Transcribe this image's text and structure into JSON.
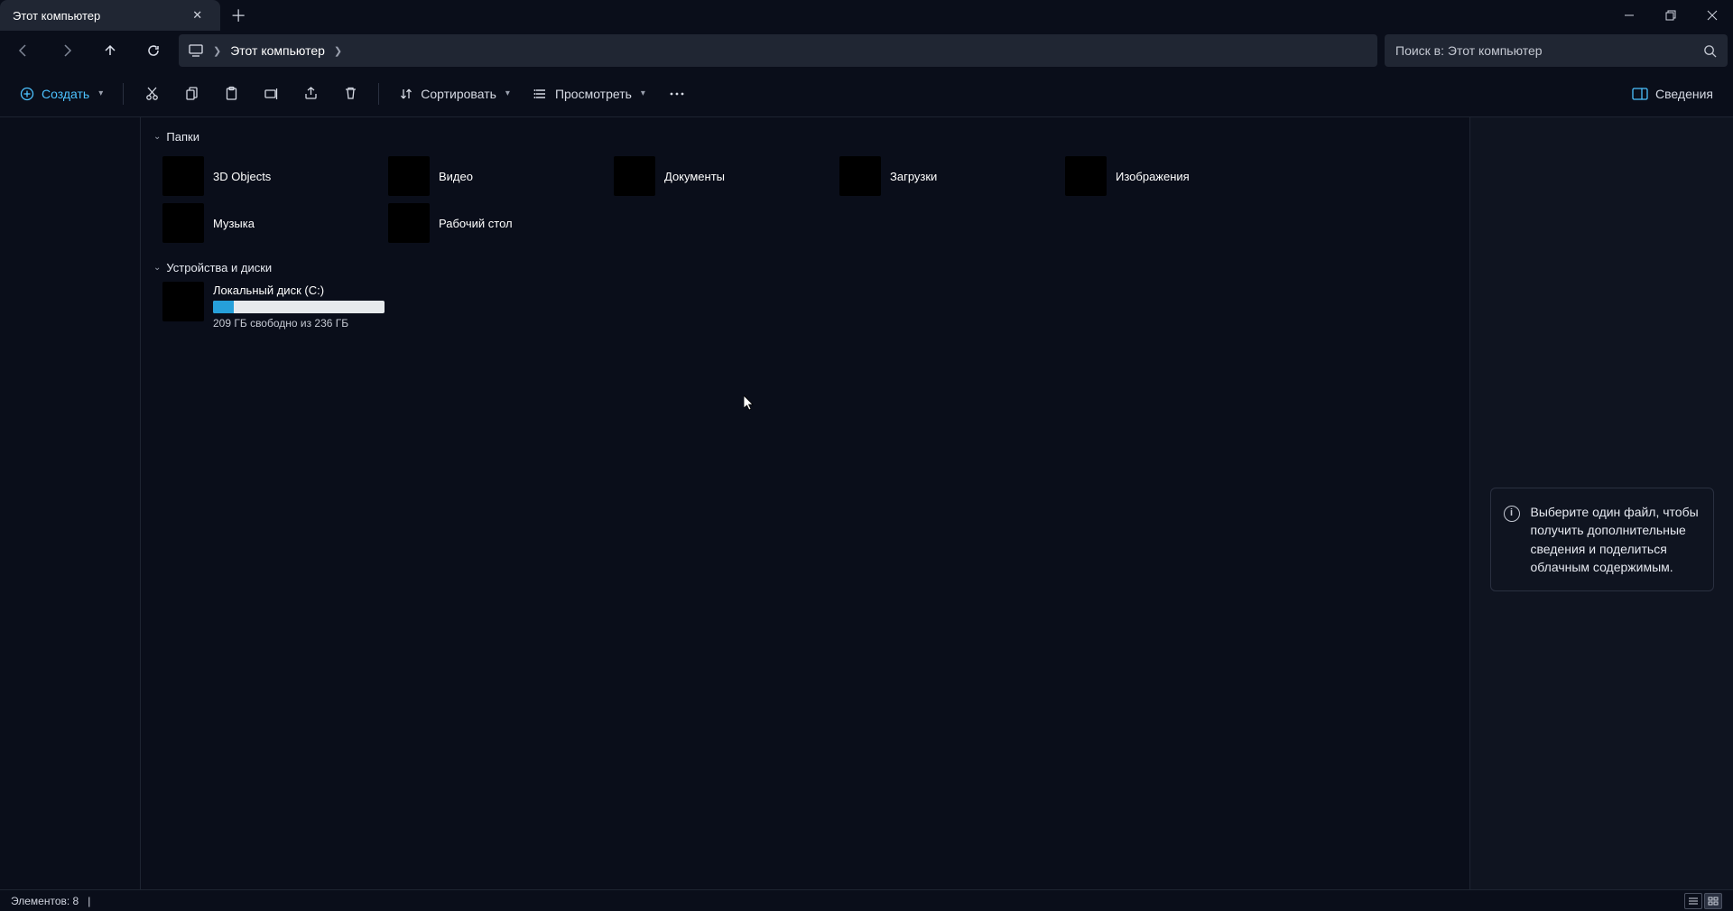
{
  "window": {
    "tab_title": "Этот компьютер"
  },
  "breadcrumb": {
    "current": "Этот компьютер"
  },
  "search": {
    "placeholder": "Поиск в: Этот компьютер"
  },
  "toolbar": {
    "new_label": "Создать",
    "sort_label": "Сортировать",
    "view_label": "Просмотреть",
    "details_label": "Сведения"
  },
  "groups": {
    "folders_label": "Папки",
    "drives_label": "Устройства и диски"
  },
  "folders": [
    {
      "label": "3D Objects"
    },
    {
      "label": "Видео"
    },
    {
      "label": "Документы"
    },
    {
      "label": "Загрузки"
    },
    {
      "label": "Изображения"
    },
    {
      "label": "Музыка"
    },
    {
      "label": "Рабочий стол"
    }
  ],
  "drive": {
    "name": "Локальный диск (C:)",
    "free_text": "209 ГБ свободно из 236 ГБ",
    "used_percent": 12
  },
  "details_message": "Выберите один файл, чтобы получить дополнительные сведения и поделиться облачным содержимым.",
  "status": {
    "items_text": "Элементов: 8"
  }
}
